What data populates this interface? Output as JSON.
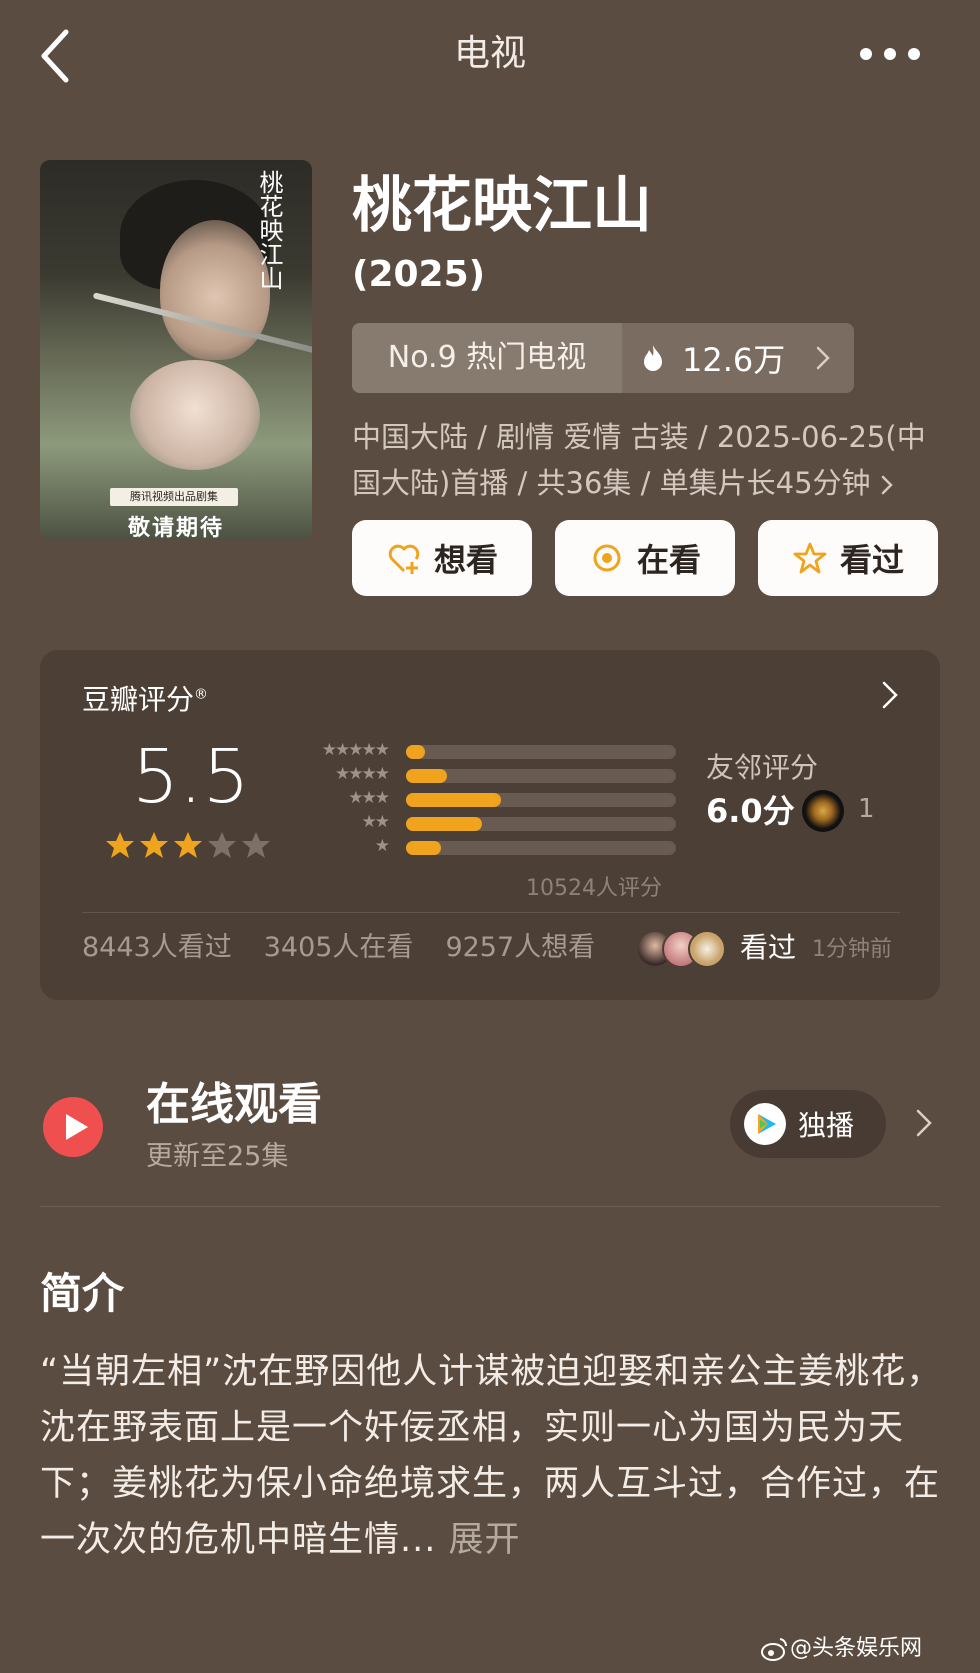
{
  "header": {
    "title": "电视"
  },
  "poster": {
    "tag": "腾讯视频出品剧集",
    "slogan": "敬请期待",
    "logo_text": "桃花映江山"
  },
  "show": {
    "title": "桃花映江山",
    "year": "(2025)",
    "rank_label": "No.9 热门电视",
    "heat": "12.6万",
    "meta": "中国大陆 / 剧情 爱情 古装 / 2025-06-25(中国大陆)首播 / 共36集 / 单集片长45分钟"
  },
  "actions": {
    "want": "想看",
    "watching": "在看",
    "watched": "看过"
  },
  "rating": {
    "source": "豆瓣评分",
    "score": "5.5",
    "star_level": 3,
    "distribution": [
      {
        "stars": "★★★★★",
        "value": 0.07
      },
      {
        "stars": "★★★★",
        "value": 0.15
      },
      {
        "stars": "★★★",
        "value": 0.35
      },
      {
        "stars": "★★",
        "value": 0.28
      },
      {
        "stars": "★",
        "value": 0.13
      }
    ],
    "votes": "10524人评分",
    "friend_label": "友邻评分",
    "friend_score": "6.0分",
    "friend_count": "1",
    "stats": {
      "watched": "8443人看过",
      "watching": "3405人在看",
      "want": "9257人想看"
    },
    "recent_label": "看过",
    "recent_time": "1分钟前"
  },
  "online": {
    "title": "在线观看",
    "subtitle": "更新至25集",
    "exclusive": "独播"
  },
  "synopsis": {
    "title": "简介",
    "body": "“当朝左相”沈在野因他人计谋被迫迎娶和亲公主姜桃花，沈在野表面上是一个奸佞丞相，实则一心为国为民为天下；姜桃花为保小命绝境求生，两人互斗过，合作过，在一次次的危机中暗生情...",
    "expand": "展开"
  },
  "watermark": "@头条娱乐网",
  "colors": {
    "background": "#5a4c41",
    "accent": "#f0a31c",
    "card": "#4c3f36",
    "play": "#ef4f4f"
  }
}
